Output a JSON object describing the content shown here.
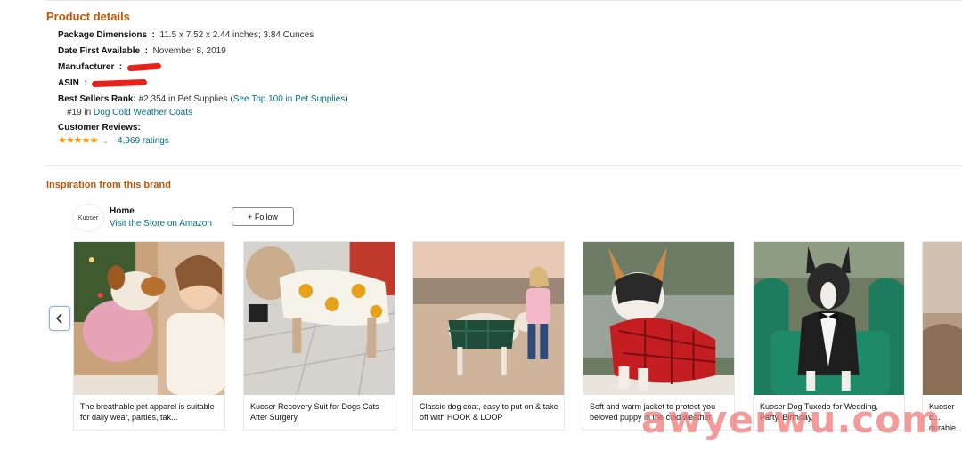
{
  "product_details": {
    "title": "Product details",
    "package_dimensions": {
      "label": "Package Dimensions ‏ : ‎",
      "value": "11.5 x 7.52 x 2.44 inches; 3.84 Ounces"
    },
    "date_first_available": {
      "label": "Date First Available ‏ : ‎",
      "value": "November 8, 2019"
    },
    "manufacturer": {
      "label": "Manufacturer ‏ : ‎"
    },
    "asin": {
      "label": "ASIN ‏ : ‎"
    },
    "best_sellers_rank": {
      "label": "Best Sellers Rank:",
      "rank_text": " #2,354 in Pet Supplies (",
      "top100_link": "See Top 100 in Pet Supplies",
      "close_paren": ")",
      "sub_rank": "#19 in ",
      "sub_link": "Dog Cold Weather Coats"
    },
    "customer_reviews": {
      "label": "Customer Reviews:",
      "stars": "★★★★★",
      "caret": "⌄",
      "ratings": "4,969 ratings",
      "rating_fraction": 0.9
    }
  },
  "inspiration": {
    "title": "Inspiration from this brand",
    "brand_logo_text": "Kuoser",
    "brand_home": "Home",
    "visit_store": "Visit the Store on Amazon",
    "follow_button": "+ Follow",
    "prev_icon": "chevron-left-icon",
    "cards": [
      {
        "caption": "The breathable pet apparel is suitable for daily wear, parties, tak..."
      },
      {
        "caption": "Kuoser Recovery Suit for Dogs Cats After Surgery"
      },
      {
        "caption": "Classic dog coat, easy to put on & take off with HOOK & LOOP"
      },
      {
        "caption": "Soft and warm jacket to protect you beloved puppy in the cold weather"
      },
      {
        "caption": "Kuoser Dog Tuxedo for Wedding, Party, Birthday,"
      },
      {
        "caption": "Kuoser d... durable"
      }
    ]
  },
  "watermark": "awyerwu.com",
  "colors": {
    "section_title": "#c45500",
    "link": "#007185",
    "star": "#ff9900",
    "redaction": "#e8221b"
  }
}
